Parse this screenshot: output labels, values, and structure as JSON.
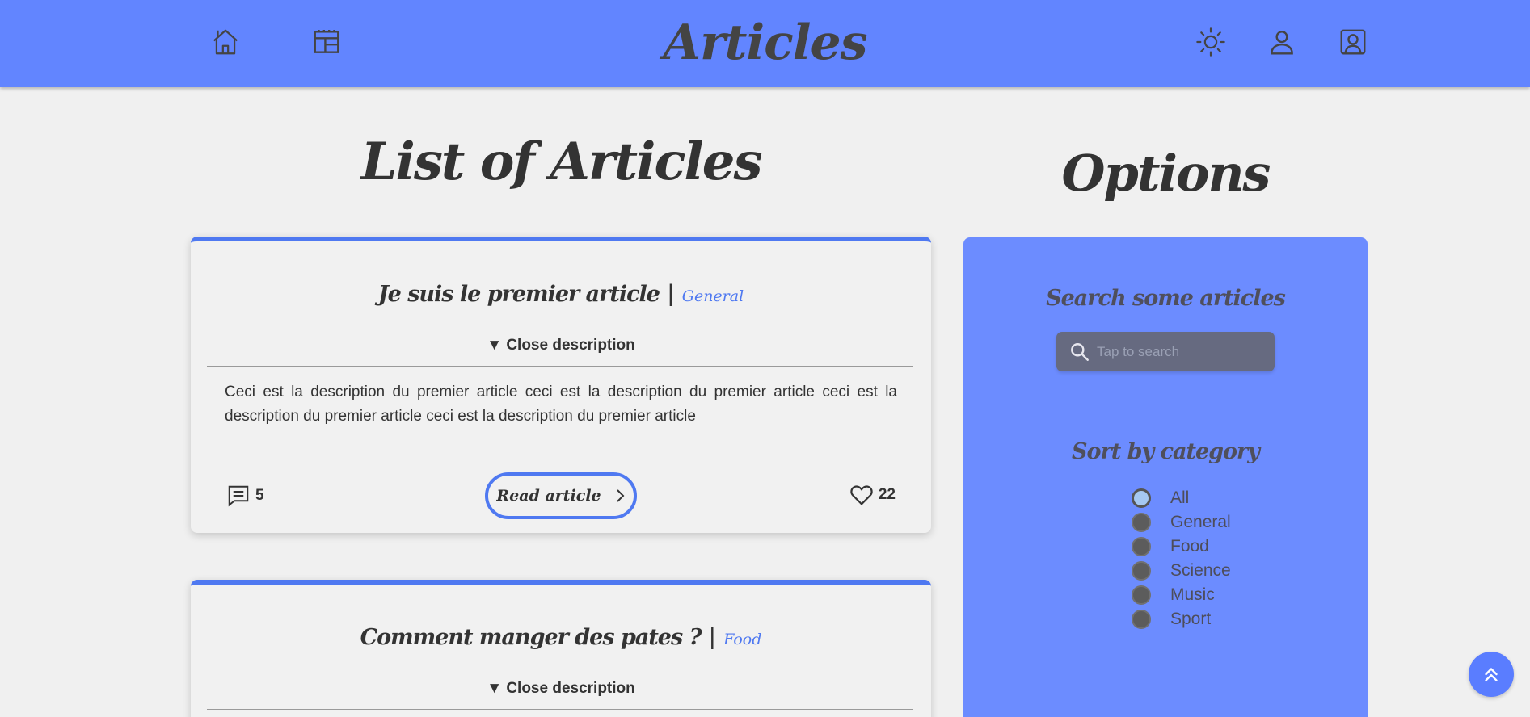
{
  "header": {
    "title": "Articles",
    "icons": [
      "home-icon",
      "layout-icon",
      "sun-icon",
      "user-icon",
      "profile-icon"
    ]
  },
  "main": {
    "list_title": "List of Articles",
    "articles": [
      {
        "title": "Je suis le premier article",
        "category": "General",
        "toggle_label": "Close description",
        "description": "Ceci est la description du premier article ceci est la description du premier article ceci est la description du premier article ceci est la description du premier article",
        "comments": "5",
        "read_label": "Read article",
        "likes": "22"
      },
      {
        "title": "Comment manger des pates ?",
        "category": "Food",
        "toggle_label": "Close description"
      }
    ]
  },
  "options": {
    "title": "Options",
    "search_label": "Search some articles",
    "search_placeholder": "Tap to search",
    "sort_label": "Sort by category",
    "categories": [
      {
        "label": "All",
        "selected": true
      },
      {
        "label": "General",
        "selected": false
      },
      {
        "label": "Food",
        "selected": false
      },
      {
        "label": "Science",
        "selected": false
      },
      {
        "label": "Music",
        "selected": false
      },
      {
        "label": "Sport",
        "selected": false
      }
    ]
  },
  "colors": {
    "header": "#6285ff",
    "accent": "#4f79f1",
    "panel": "#6c8cff",
    "background": "#f0f0f0"
  }
}
